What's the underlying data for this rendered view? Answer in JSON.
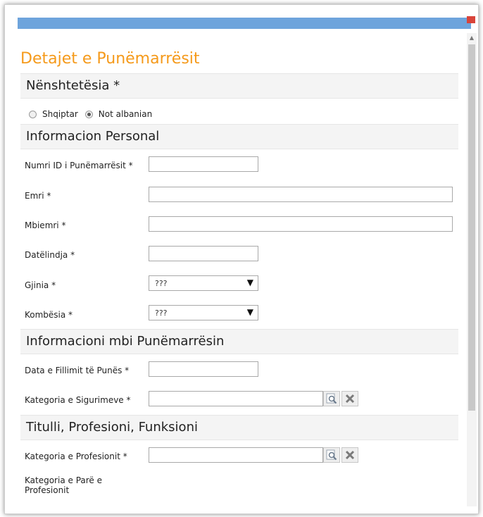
{
  "form": {
    "title": "Detajet e Punëmarrësit"
  },
  "sections": {
    "citizenship": "Nënshtetësia *",
    "personal": "Informacion Personal",
    "employment": "Informacioni mbi Punëmarrësin",
    "profession": "Titulli, Profesioni, Funksioni"
  },
  "citizenship_options": {
    "option1": "Shqiptar",
    "option2": "Not albanian",
    "selected": "Not albanian"
  },
  "labels": {
    "employee_id": "Numri ID i Punëmarrësit *",
    "first_name": "Emri *",
    "last_name": "Mbiemri *",
    "birth_date": "Datëlindja *",
    "gender": "Gjinia *",
    "nationality": "Kombësia *",
    "start_date": "Data e Fillimit të Punës *",
    "insurance_category": "Kategoria e Sigurimeve *",
    "profession_category": "Kategoria e Profesionit *",
    "first_profession_category_line1": "Kategoria e Parë e",
    "first_profession_category_line2": "Profesionit"
  },
  "fields": {
    "employee_id": "",
    "first_name": "",
    "last_name": "",
    "birth_date": "",
    "start_date": "",
    "insurance_category": "",
    "profession_category": ""
  },
  "selects": {
    "gender": "???",
    "nationality": "???"
  },
  "colors": {
    "title": "#f59a1b",
    "top_bar": "#6ea4dc",
    "section_bg": "#f4f4f4"
  },
  "icons": {
    "lookup": "magnifier-icon",
    "clear": "x-icon",
    "dropdown": "triangle-down-icon"
  }
}
